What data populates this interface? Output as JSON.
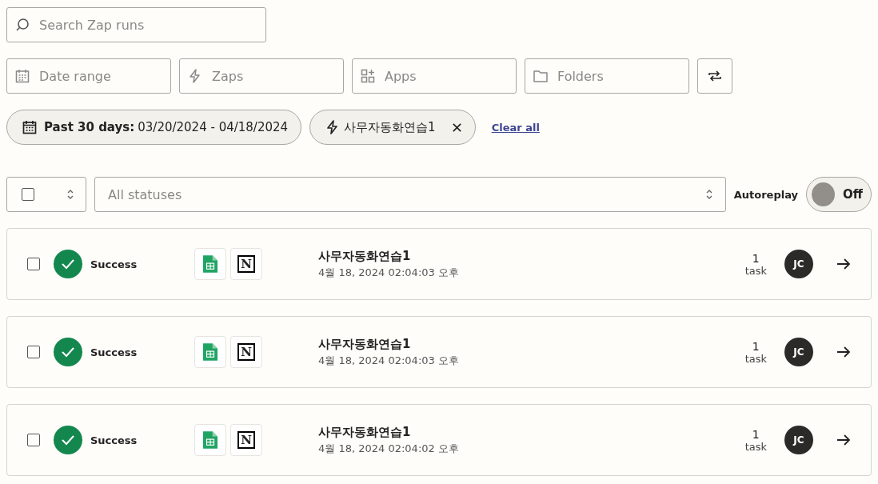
{
  "search": {
    "placeholder": "Search Zap runs"
  },
  "filters": [
    {
      "kind": "calendar",
      "placeholder": "Date range"
    },
    {
      "kind": "bolt",
      "placeholder": "Zaps"
    },
    {
      "kind": "apps",
      "placeholder": "Apps"
    },
    {
      "kind": "folder",
      "placeholder": "Folders"
    }
  ],
  "active_filters": [
    {
      "kind": "date",
      "label": "Past 30 days:",
      "value": "03/20/2024 - 04/18/2024"
    },
    {
      "kind": "zap",
      "value": "사무자동화연습1",
      "removable": true
    }
  ],
  "clear_all": "Clear all",
  "select_all": {
    "checked": false
  },
  "status_filter": {
    "placeholder": "All statuses"
  },
  "autoreplay": {
    "label": "Autoreplay",
    "on": false,
    "state": "Off"
  },
  "runs": [
    {
      "checked": false,
      "status": "Success",
      "apps": [
        {
          "kind": "sheets"
        },
        {
          "kind": "notion",
          "glyph": "N"
        }
      ],
      "zap": "사무자동화연습1",
      "time": "4월 18, 2024 02:04:03 오후",
      "count": "1",
      "unit": "task",
      "owner": "JC"
    },
    {
      "checked": false,
      "status": "Success",
      "apps": [
        {
          "kind": "sheets"
        },
        {
          "kind": "notion",
          "glyph": "N"
        }
      ],
      "zap": "사무자동화연습1",
      "time": "4월 18, 2024 02:04:03 오후",
      "count": "1",
      "unit": "task",
      "owner": "JC"
    },
    {
      "checked": false,
      "status": "Success",
      "apps": [
        {
          "kind": "sheets"
        },
        {
          "kind": "notion",
          "glyph": "N"
        }
      ],
      "zap": "사무자동화연습1",
      "time": "4월 18, 2024 02:04:02 오후",
      "count": "1",
      "unit": "task",
      "owner": "JC"
    }
  ]
}
